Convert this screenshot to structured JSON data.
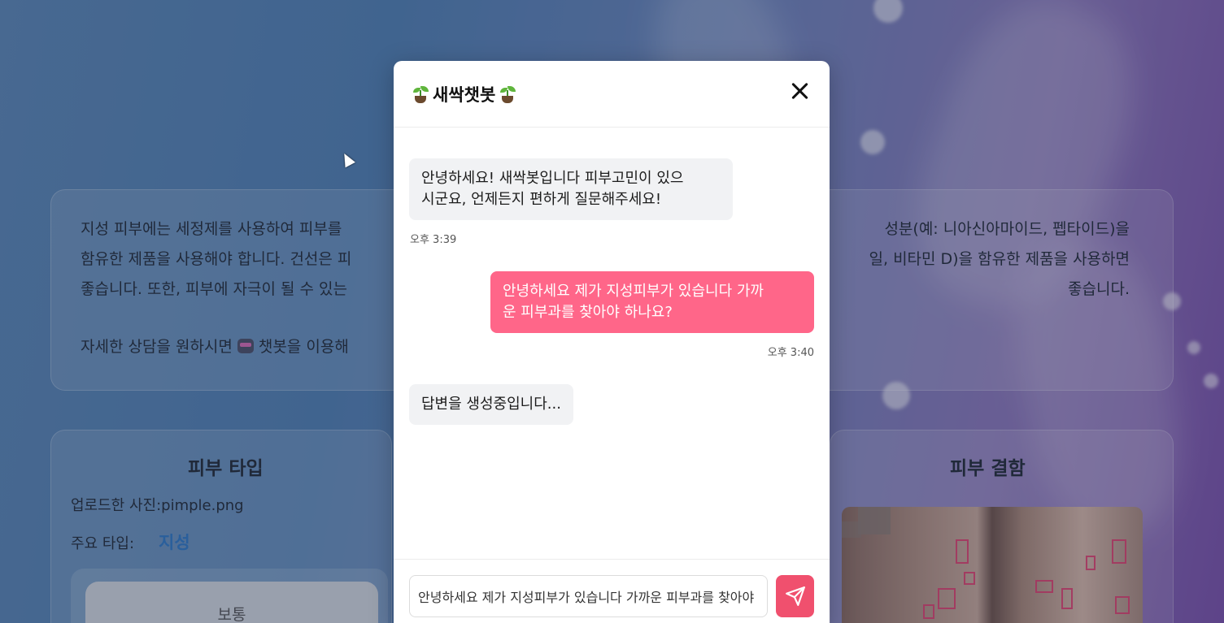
{
  "background": {
    "description_text": "지성 피부에는 세정제를 사용하여 피부를 ██████████████████████████████ 성분(예: 니아신아마이드, 펩타이드)을 함유한 제품을 사용해야 합니다. 건선은 피██████████████████████████████일, 비타민 D)을 함유한 제품을 사용하면 좋습니다. 또한, 피부에 자극이 될 수 있는 ██████████████████████████████ 좋습니다.",
    "line1_left": "지성 피부에는 세정제를 사용하여 피부를",
    "line1_right": "성분(예: 니아신아마이드, 펩타이드)을",
    "line2_left": "함유한 제품을 사용해야 합니다. 건선은 피",
    "line2_right": "일, 비타민 D)을 함유한 제품을 사용하면",
    "line3_left": "좋습니다. 또한, 피부에 자극이 될 수 있는",
    "line3_right": "좋습니다.",
    "more_prefix": "자세한 상담을 원하시면",
    "more_suffix": "챗봇을 이용해",
    "skin_type_title": "피부 타입",
    "uploaded_photo": "업로드한 사진:pimple.png",
    "main_type_label": "주요 타입:",
    "main_type_value": "지성",
    "type_option": "보통",
    "defect_title": "피부 결함"
  },
  "chat": {
    "title": "새싹챗봇",
    "messages": [
      {
        "sender": "bot",
        "text": "안녕하세요! 새싹봇입니다 피부고민이 있으시군요, 언제든지 편하게 질문해주세요!",
        "line1": "안녕하세요! 새싹봇입니다 피부고민이 있으",
        "line2": "시군요, 언제든지 편하게 질문해주세요!",
        "time": "오후 3:39"
      },
      {
        "sender": "user",
        "text": "안녕하세요 제가 지성피부가 있습니다 가까운 피부과를 찾아야 하나요?",
        "line1": "안녕하세요 제가 지성피부가 있습니다 가까",
        "line2": "운 피부과를 찾아야 하나요?",
        "time": "오후 3:40"
      },
      {
        "sender": "bot",
        "text": "답변을 생성중입니다..."
      }
    ],
    "input_value": "안녕하세요 제가 지성피부가 있습니다 가까운 피부과를 찾아야 하나요?"
  },
  "colors": {
    "user_bubble": "#ff6689",
    "send_button": "#f0506e",
    "accent_type": "#2f78c4"
  }
}
